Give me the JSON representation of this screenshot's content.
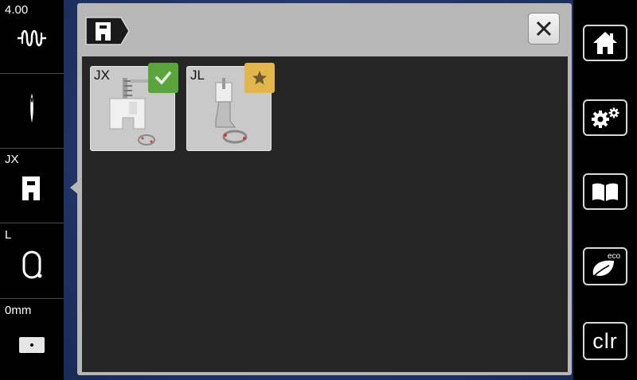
{
  "left_sidebar": {
    "stitch_width": "4.00",
    "presser_foot": "JX",
    "stitch_plate": "L",
    "needle_position": "0mm"
  },
  "dialog": {
    "feet": [
      {
        "label": "JX",
        "badge": "checkmark",
        "badge_color": "#5aa53b"
      },
      {
        "label": "JL",
        "badge": "star",
        "badge_color": "#e2b64b"
      }
    ]
  },
  "right_sidebar": {
    "clear_label": "clr",
    "eco_label": "eco"
  }
}
